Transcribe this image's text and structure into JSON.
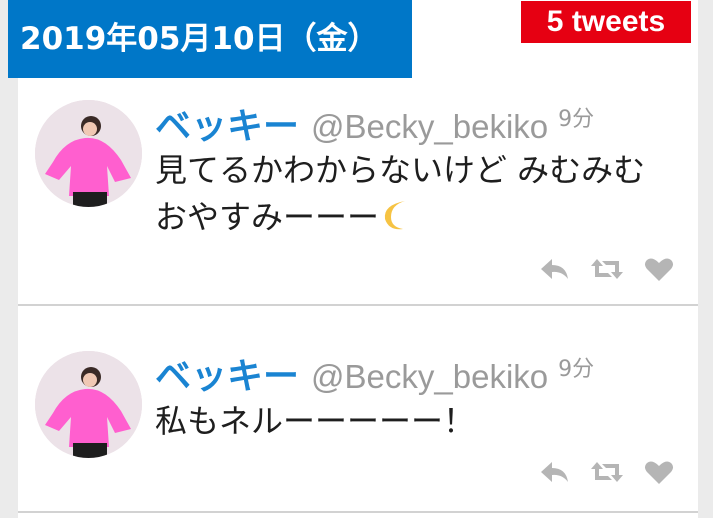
{
  "header": {
    "date": "2019年05月10日（金）",
    "tweet_count": "5 tweets"
  },
  "colors": {
    "banner_blue": "#0077c8",
    "badge_red": "#e60012",
    "name_blue": "#1a84d2",
    "muted_gray": "#9a9a9a"
  },
  "tweets": [
    {
      "display_name": "ベッキー",
      "handle": "@Becky_bekiko",
      "time": "9分",
      "text": "見てるかわからないけど みむみむ おやすみーーー",
      "emoji": "crescent-moon-icon",
      "actions": [
        "reply-icon",
        "retweet-icon",
        "like-icon"
      ]
    },
    {
      "display_name": "ベッキー",
      "handle": "@Becky_bekiko",
      "time": "9分",
      "text": "私もネルーーーーー！",
      "actions": [
        "reply-icon",
        "retweet-icon",
        "like-icon"
      ]
    }
  ]
}
